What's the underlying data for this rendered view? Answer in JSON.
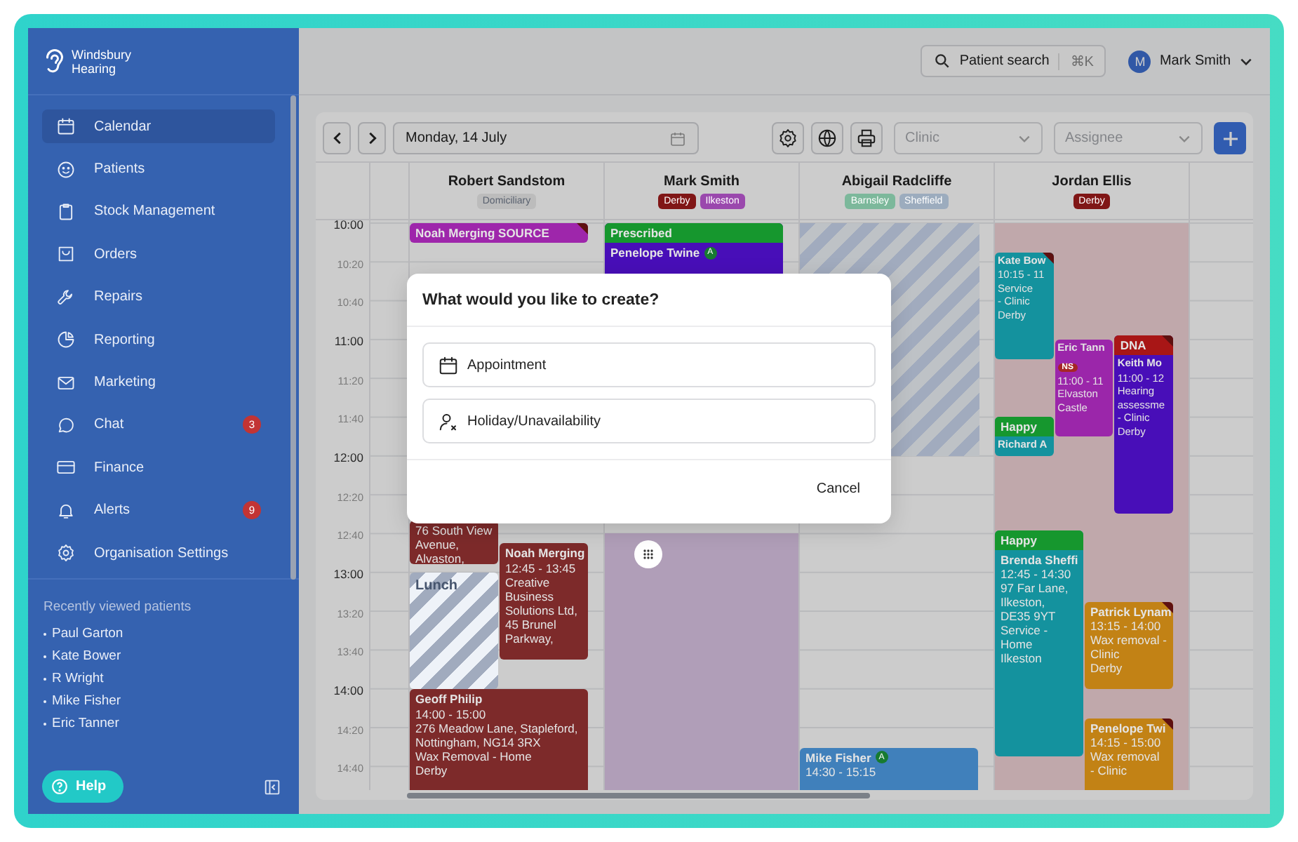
{
  "brand": {
    "name": "Windsbury Hearing"
  },
  "nav": [
    {
      "label": "Calendar",
      "selected": true
    },
    {
      "label": "Patients",
      "selected": false
    },
    {
      "label": "Stock Management",
      "selected": false
    },
    {
      "label": "Orders",
      "selected": false
    },
    {
      "label": "Repairs",
      "selected": false
    },
    {
      "label": "Reporting",
      "selected": false
    },
    {
      "label": "Marketing",
      "selected": false
    },
    {
      "label": "Chat",
      "selected": false,
      "badge": "3"
    },
    {
      "label": "Finance",
      "selected": false
    },
    {
      "label": "Alerts",
      "selected": false,
      "badge": "9"
    },
    {
      "label": "Organisation Settings",
      "selected": false
    }
  ],
  "recent": {
    "title": "Recently viewed patients",
    "items": [
      "Paul Garton",
      "Kate Bower",
      "R Wright",
      "Mike Fisher",
      "Eric Tanner"
    ]
  },
  "help": {
    "label": "Help"
  },
  "topbar": {
    "search": {
      "label": "Patient search",
      "shortcut": "⌘K"
    },
    "user": {
      "initial": "M",
      "name": "Mark Smith"
    }
  },
  "toolbar": {
    "date": "Monday, 14 July",
    "selects": [
      {
        "placeholder": "Clinic"
      },
      {
        "placeholder": "Assignee"
      }
    ]
  },
  "calendar": {
    "times": [
      {
        "label": "10:00",
        "major": true
      },
      {
        "label": "10:20",
        "major": false
      },
      {
        "label": "10:40",
        "major": false
      },
      {
        "label": "11:00",
        "major": true
      },
      {
        "label": "11:20",
        "major": false
      },
      {
        "label": "11:40",
        "major": false
      },
      {
        "label": "12:00",
        "major": true
      },
      {
        "label": "12:20",
        "major": false
      },
      {
        "label": "12:40",
        "major": false
      },
      {
        "label": "13:00",
        "major": true
      },
      {
        "label": "13:20",
        "major": false
      },
      {
        "label": "13:40",
        "major": false
      },
      {
        "label": "14:00",
        "major": true
      },
      {
        "label": "14:20",
        "major": false
      },
      {
        "label": "14:40",
        "major": false
      }
    ],
    "columns": [
      {
        "name": "Robert Sandstom",
        "tags": [
          {
            "text": "Domiciliary",
            "color": "#bcbcbc"
          }
        ],
        "events": [
          {
            "kind": "appointment",
            "title": "Noah Merging SOURCE",
            "color": "#9e26ab",
            "flag": true
          },
          {
            "kind": "appointment",
            "color": "#7d2a2a",
            "flag": false,
            "lines": [
              "76 South View Avenue, Alvaston,"
            ]
          },
          {
            "kind": "appointment",
            "title": "Noah Merging",
            "color": "#7d2a2a",
            "flag": false,
            "lines": [
              "12:45 - 13:45",
              "Creative Business Solutions Ltd, 45 Brunel Parkway,"
            ]
          },
          {
            "kind": "break",
            "title": "Lunch",
            "color": "#a1abbe",
            "flag": false
          },
          {
            "kind": "appointment",
            "title": "Geoff Philip",
            "color": "#7d2a2a",
            "flag": false,
            "lines": [
              "14:00 - 15:00",
              "276 Meadow Lane, Stapleford, Nottingham, NG14 3RX",
              "Wax Removal - Home",
              "Derby"
            ]
          }
        ]
      },
      {
        "name": "Mark Smith",
        "tags": [
          {
            "text": "Derby",
            "color": "#801616"
          },
          {
            "text": "Ilkeston",
            "color": "#9a48ad"
          }
        ],
        "blocks": [
          {
            "kind": "shade",
            "color": "#b09eb8"
          }
        ],
        "events": [
          {
            "kind": "appointment",
            "title": "Penelope Twine",
            "status": {
              "text": "Prescribed",
              "color": "#16972e"
            },
            "badge": {
              "text": "A",
              "color": "#177b30"
            },
            "color": "#480eb8",
            "flag": false
          }
        ]
      },
      {
        "name": "Abigail Radcliffe",
        "tags": [
          {
            "text": "Barnsley",
            "color": "#7cb89b"
          },
          {
            "text": "Sheffield",
            "color": "#9cacbe"
          }
        ],
        "blocks": [
          {
            "kind": "hatch",
            "color": "#a1abbe"
          }
        ],
        "events": [
          {
            "kind": "appointment",
            "title": "Mike Fisher",
            "badge": {
              "text": "A",
              "color": "#177b30"
            },
            "color": "#4080bb",
            "flag": false,
            "lines": [
              "14:30 - 15:15"
            ]
          }
        ]
      },
      {
        "name": "Jordan Ellis",
        "tags": [
          {
            "text": "Derby",
            "color": "#801616"
          }
        ],
        "blocks": [
          {
            "kind": "shade",
            "color": "#c0a8ab"
          }
        ],
        "events": [
          {
            "kind": "appointment",
            "title": "Kate Bow",
            "color": "#14929e",
            "flag": true,
            "lines": [
              "10:15 - 11",
              "Service",
              "- Clinic",
              "Derby"
            ]
          },
          {
            "kind": "appointment",
            "title": "Eric Tann",
            "badge": {
              "text": "NS",
              "color": "#a62626"
            },
            "color": "#9b26aa",
            "flag": false,
            "lines": [
              "11:00 - 11",
              "Elvaston",
              "Castle"
            ]
          },
          {
            "kind": "appointment",
            "title": "Keith Mo",
            "status": {
              "text": "DNA",
              "color": "#a81616"
            },
            "color": "#480eb8",
            "flag": true,
            "lines": [
              "11:00 - 12",
              "Hearing",
              "assessme",
              "- Clinic",
              "Derby"
            ]
          },
          {
            "kind": "appointment",
            "title": "Richard A",
            "status": {
              "text": "Happy",
              "color": "#16972e"
            },
            "color": "#14929e",
            "flag": false
          },
          {
            "kind": "appointment",
            "title": "Brenda Sheffi",
            "status": {
              "text": "Happy",
              "color": "#16972e"
            },
            "color": "#14929e",
            "flag": false,
            "lines": [
              "12:45 - 14:30",
              "97 Far Lane, Ilkeston, DE35 9YT",
              "Service - Home",
              "Ilkeston"
            ]
          },
          {
            "kind": "appointment",
            "title": "Patrick Lynam",
            "color": "#c28215",
            "flag": true,
            "lines": [
              "13:15 - 14:00",
              "Wax removal - Clinic",
              "Derby"
            ]
          },
          {
            "kind": "appointment",
            "title": "Penelope Twi",
            "color": "#c28215",
            "flag": true,
            "lines": [
              "14:15 - 15:00",
              "Wax removal",
              "- Clinic"
            ]
          }
        ]
      }
    ]
  },
  "modal": {
    "title": "What would you like to create?",
    "options": [
      {
        "label": "Appointment"
      },
      {
        "label": "Holiday/Unavailability"
      }
    ],
    "cancel": "Cancel"
  }
}
